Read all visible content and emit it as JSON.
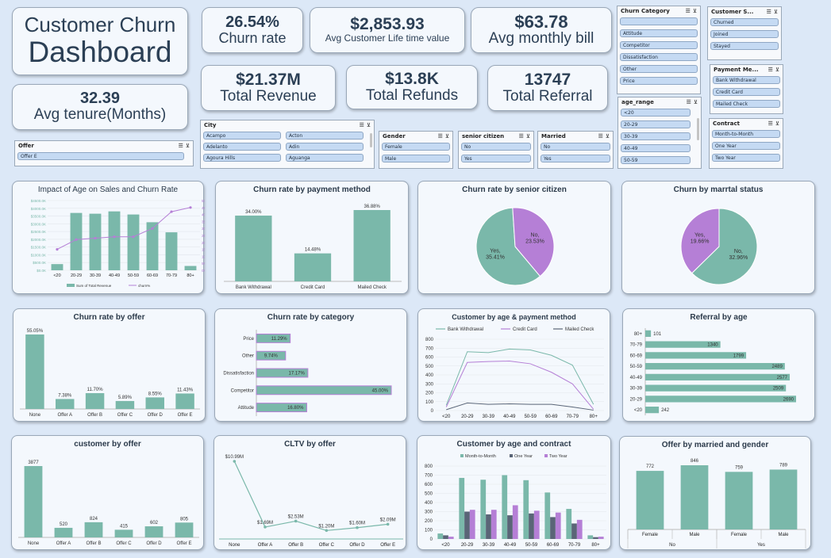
{
  "kpis": {
    "title_line1": "Customer Churn",
    "title_line2": "Dashboard",
    "churn_rate": {
      "value": "26.54%",
      "label": "Churn rate"
    },
    "clv": {
      "value": "$2,853.93",
      "label": "Avg Customer Life time value"
    },
    "monthly_bill": {
      "value": "$63.78",
      "label": "Avg monthly bill"
    },
    "tenure": {
      "value": "32.39",
      "label": "Avg tenure(Months)"
    },
    "revenue": {
      "value": "$21.37M",
      "label": "Total Revenue"
    },
    "refunds": {
      "value": "$13.8K",
      "label": "Total Refunds"
    },
    "referral": {
      "value": "13747",
      "label": "Total Referral"
    }
  },
  "slicers": {
    "churn_category": {
      "title": "Churn Category",
      "items": [
        "",
        "Attitude",
        "Competitor",
        "Dissatisfaction",
        "Other",
        "Price"
      ]
    },
    "customer_status": {
      "title": "Customer S...",
      "items": [
        "Churned",
        "Joined",
        "Stayed"
      ]
    },
    "payment_method": {
      "title": "Payment Me...",
      "items": [
        "Bank Withdrawal",
        "Credit Card",
        "Mailed Check"
      ]
    },
    "contract": {
      "title": "Contract",
      "items": [
        "Month-to-Month",
        "One Year",
        "Two Year"
      ]
    },
    "age_range": {
      "title": "age_range",
      "items": [
        "<20",
        "20-29",
        "30-39",
        "40-49",
        "50-59"
      ]
    },
    "city": {
      "title": "City",
      "items": [
        "Acampo",
        "Acton",
        "Adelanto",
        "Adin",
        "Agoura Hills",
        "Aguanga"
      ]
    },
    "gender": {
      "title": "Gender",
      "items": [
        "Female",
        "Male"
      ]
    },
    "senior": {
      "title": "senior citizen",
      "items": [
        "No",
        "Yes"
      ]
    },
    "married": {
      "title": "Married",
      "items": [
        "No",
        "Yes"
      ]
    },
    "offer": {
      "title": "Offer",
      "items": [
        "Offer E"
      ]
    }
  },
  "colors": {
    "teal": "#7ab8aa",
    "purple": "#b57fd6",
    "dark": "#5a6577"
  },
  "charts": {
    "age_sales": {
      "title": "Impact of Age on Sales and Churn Rate",
      "legend": [
        "Sum of Total Revenue",
        "churn%"
      ],
      "chart_data": {
        "type": "bar",
        "categories": [
          "<20",
          "20-29",
          "30-39",
          "40-49",
          "50-59",
          "60-69",
          "70-79",
          "80+"
        ],
        "series": [
          {
            "name": "Sum of Total Revenue",
            "values": [
              400,
              3700,
              3650,
              3800,
              3600,
              3100,
              2450,
              280
            ]
          },
          {
            "name": "churn%",
            "values": [
              15,
              22,
              23,
              24,
              24,
              30,
              42,
              45
            ]
          }
        ],
        "y_ticks": [
          "$0.0K",
          "$500.0K",
          "$1000.0K",
          "$1500.0K",
          "$2000.0K",
          "$2500.0K",
          "$3000.0K",
          "$3500.0K",
          "$4000.0K",
          "$4500.0K"
        ],
        "y2_ticks": [
          "0%",
          "5%",
          "10%",
          "15%",
          "20%",
          "25%",
          "30%",
          "35%",
          "40%",
          "45%",
          "50%"
        ],
        "ylim": [
          0,
          4500
        ],
        "y2lim": [
          0,
          50
        ]
      }
    },
    "payment": {
      "title": "Churn rate by payment method",
      "chart_data": {
        "type": "bar",
        "categories": [
          "Bank Withdrawal",
          "Credit Card",
          "Mailed Check"
        ],
        "values": [
          34.0,
          14.48,
          36.88
        ],
        "labels": [
          "34.00%",
          "14.48%",
          "36.88%"
        ]
      }
    },
    "senior": {
      "title": "Churn rate by senior citizen",
      "chart_data": {
        "type": "pie",
        "categories": [
          "Yes",
          "No"
        ],
        "values": [
          35.41,
          23.53
        ],
        "labels": [
          "Yes,\n35.41%",
          "No,\n23.53%"
        ]
      }
    },
    "marital": {
      "title": "Churn by marrtal status",
      "chart_data": {
        "type": "pie",
        "categories": [
          "No",
          "Yes"
        ],
        "values": [
          32.96,
          19.66
        ],
        "labels": [
          "No,\n32.96%",
          "Yes,\n19.66%"
        ]
      }
    },
    "offer_rate": {
      "title": "Churn rate by offer",
      "chart_data": {
        "type": "bar",
        "categories": [
          "None",
          "Offer A",
          "Offer B",
          "Offer C",
          "Offer D",
          "Offer E"
        ],
        "values": [
          55.05,
          7.38,
          11.7,
          5.89,
          8.55,
          11.43
        ],
        "labels": [
          "55.05%",
          "7.38%",
          "11.70%",
          "5.89%",
          "8.55%",
          "11.43%"
        ]
      }
    },
    "category": {
      "title": "Churn rate by category",
      "chart_data": {
        "type": "bar",
        "categories": [
          "Price",
          "Other",
          "Dissatisfaction",
          "Competitor",
          "Attitude"
        ],
        "values": [
          11.29,
          9.74,
          17.17,
          45.0,
          16.8
        ],
        "labels": [
          "11.29%",
          "9.74%",
          "17.17%",
          "45.00%",
          "16.80%"
        ]
      }
    },
    "age_payment": {
      "title": "Customer by age & payment method",
      "legend": [
        "Bank Withdrawal",
        "Credit Card",
        "Mailed Check"
      ],
      "chart_data": {
        "type": "line",
        "categories": [
          "<20",
          "20-29",
          "30-39",
          "40-49",
          "50-59",
          "60-69",
          "70-79",
          "80+"
        ],
        "series": [
          {
            "name": "Bank Withdrawal",
            "values": [
              60,
              660,
              650,
              690,
              680,
              620,
              510,
              70
            ]
          },
          {
            "name": "Credit Card",
            "values": [
              40,
              540,
              550,
              555,
              525,
              430,
              300,
              15
            ]
          },
          {
            "name": "Mailed Check",
            "values": [
              10,
              85,
              70,
              75,
              70,
              70,
              40,
              5
            ]
          }
        ],
        "y_ticks": [
          "0",
          "100",
          "200",
          "300",
          "400",
          "500",
          "600",
          "700",
          "800"
        ],
        "ylim": [
          0,
          800
        ]
      }
    },
    "referral_age": {
      "title": "Referral by age",
      "chart_data": {
        "type": "bar",
        "categories": [
          "80+",
          "70-79",
          "60-69",
          "50-59",
          "40-49",
          "30-39",
          "20-29",
          "<20"
        ],
        "values": [
          101,
          1340,
          1799,
          2489,
          2577,
          2509,
          2690,
          242
        ],
        "labels": [
          "101",
          "1340",
          "1799",
          "2489",
          "2577",
          "2509",
          "2690",
          "242"
        ]
      }
    },
    "customer_offer": {
      "title": "customer by offer",
      "chart_data": {
        "type": "bar",
        "categories": [
          "None",
          "Offer A",
          "Offer B",
          "Offer C",
          "Offer D",
          "Offer E"
        ],
        "values": [
          3877,
          520,
          824,
          415,
          602,
          805
        ],
        "labels": [
          "3877",
          "520",
          "824",
          "415",
          "602",
          "805"
        ]
      }
    },
    "cltv_offer": {
      "title": "CLTV by offer",
      "chart_data": {
        "type": "line",
        "categories": [
          "None",
          "Offer A",
          "Offer B",
          "Offer C",
          "Offer D",
          "Offer E"
        ],
        "values": [
          10.99,
          1.69,
          2.53,
          1.2,
          1.6,
          2.09
        ],
        "labels": [
          "$10.99M",
          "$1.69M",
          "$2.53M",
          "$1.20M",
          "$1.60M",
          "$2.09M"
        ]
      }
    },
    "age_contract": {
      "title": "Customer by age and contract",
      "legend": [
        "Month-to-Month",
        "One Year",
        "Two Year"
      ],
      "chart_data": {
        "type": "bar",
        "categories": [
          "<20",
          "20-29",
          "30-39",
          "40-49",
          "50-59",
          "60-69",
          "70-79",
          "80+"
        ],
        "series": [
          {
            "name": "Month-to-Month",
            "values": [
              60,
              670,
              650,
              700,
              645,
              510,
              330,
              40
            ]
          },
          {
            "name": "One Year",
            "values": [
              40,
              300,
              270,
              260,
              280,
              240,
              170,
              20
            ]
          },
          {
            "name": "Two Year",
            "values": [
              25,
              320,
              320,
              370,
              310,
              290,
              210,
              25
            ]
          }
        ],
        "y_ticks": [
          "0",
          "100",
          "200",
          "300",
          "400",
          "500",
          "600",
          "700",
          "800"
        ],
        "ylim": [
          0,
          800
        ]
      }
    },
    "married_gender": {
      "title": "Offer by married and gender",
      "chart_data": {
        "type": "bar",
        "categories": [
          "Female",
          "Male",
          "Female",
          "Male"
        ],
        "groups": [
          "No",
          "Yes"
        ],
        "values": [
          772,
          846,
          759,
          789
        ],
        "labels": [
          "772",
          "846",
          "759",
          "789"
        ]
      }
    }
  }
}
